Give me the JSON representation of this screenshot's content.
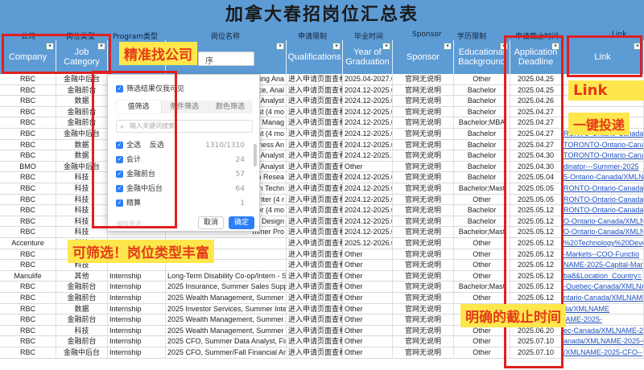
{
  "page": {
    "title": "加拿大春招岗位汇总表"
  },
  "sub_header": {
    "labels": [
      "公司",
      "岗位类型",
      "Program类型",
      "岗位名称",
      "申请限制",
      "毕业时间",
      "Sponsor",
      "学历限制",
      "申请截止时间",
      "Link"
    ]
  },
  "columns": [
    {
      "label": "Company"
    },
    {
      "label": "Job Category"
    },
    {
      "label": ""
    },
    {
      "label": ""
    },
    {
      "label": "Qualifications"
    },
    {
      "label": "Year of Graduation"
    },
    {
      "label": "Sponsor"
    },
    {
      "label": "Educational Background"
    },
    {
      "label": "Application Deadline"
    },
    {
      "label": "Link"
    }
  ],
  "rows": [
    {
      "company": "RBC",
      "cat": "金融中后台",
      "prog": "",
      "name": "",
      "qual": "进入申请页面查看",
      "year": "2025.04-2027.04",
      "spon": "官网无说明",
      "edu": "Other",
      "deadline": "2025.04.25",
      "link": ""
    },
    {
      "company": "RBC",
      "cat": "金融前台",
      "prog": "",
      "name": "",
      "qual": "进入申请页面查看",
      "year": "2024.12-2025.08",
      "spon": "官网无说明",
      "edu": "Bachelor",
      "deadline": "2025.04.25",
      "link": ""
    },
    {
      "company": "RBC",
      "cat": "数据",
      "prog": "",
      "name": "",
      "qual": "进入申请页面查看",
      "year": "2024.12-2025.08",
      "spon": "官网无说明",
      "edu": "Bachelor",
      "deadline": "2025.04.26",
      "link": ""
    },
    {
      "company": "RBC",
      "cat": "金融前台",
      "prog": "",
      "name": "",
      "qual": "进入申请页面查看",
      "year": "2024.12-2025.08",
      "spon": "官网无说明",
      "edu": "Bachelor",
      "deadline": "2025.04.27",
      "link": ""
    },
    {
      "company": "RBC",
      "cat": "金融前台",
      "prog": "",
      "name": "",
      "qual": "进入申请页面查看",
      "year": "2024.12-2025.08",
      "spon": "官网无说明",
      "edu": "Bachelor;MBA",
      "deadline": "2025.04.27",
      "link": ""
    },
    {
      "company": "RBC",
      "cat": "金融中后台",
      "prog": "",
      "name": "",
      "qual": "进入申请页面查看",
      "year": "2024.12-2025.08",
      "spon": "官网无说明",
      "edu": "Bachelor",
      "deadline": "2025.04.27",
      "link": "RONTO-Ontario-Canada/"
    },
    {
      "company": "RBC",
      "cat": "数据",
      "prog": "",
      "name": "",
      "qual": "进入申请页面查看",
      "year": "2024.12-2025.08",
      "spon": "官网无说明",
      "edu": "Bachelor",
      "deadline": "2025.04.27",
      "link": "TORONTO-Ontario-Canada/"
    },
    {
      "company": "RBC",
      "cat": "数据",
      "prog": "",
      "name": "",
      "qual": "进入申请页面查看",
      "year": "2024.12-2025.12",
      "spon": "官网无说明",
      "edu": "Bachelor",
      "deadline": "2025.04.30",
      "link": "TORONTO-Ontario-Canada/"
    },
    {
      "company": "BMO",
      "cat": "金融中后台",
      "prog": "",
      "name": "",
      "qual": "进入申请页面查看",
      "year": "Other",
      "spon": "官网无说明",
      "edu": "Bachelor",
      "deadline": "2025.04.30",
      "link": "dinator---Summer-2025"
    },
    {
      "company": "RBC",
      "cat": "科技",
      "prog": "",
      "name": "",
      "qual": "进入申请页面查看",
      "year": "2024.12-2025.08",
      "spon": "官网无说明",
      "edu": "Bachelor",
      "deadline": "2025.05.04",
      "link": "5-Ontario-Canada/XMLN"
    },
    {
      "company": "RBC",
      "cat": "科技",
      "prog": "",
      "name": "",
      "qual": "进入申请页面查看",
      "year": "2024.12-2025.08",
      "spon": "官网无说明",
      "edu": "Bachelor;Mast",
      "deadline": "2025.05.05",
      "link": "RONTO-Ontario-Canada/XMLN"
    },
    {
      "company": "RBC",
      "cat": "科技",
      "prog": "",
      "name": "",
      "qual": "进入申请页面查看",
      "year": "2024.12-2025.08",
      "spon": "官网无说明",
      "edu": "Other",
      "deadline": "2025.05.05",
      "link": "RONTO-Ontario-Canada/XMLN"
    },
    {
      "company": "RBC",
      "cat": "科技",
      "prog": "",
      "name": "",
      "qual": "进入申请页面查看",
      "year": "2024.12-2025.08",
      "spon": "官网无说明",
      "edu": "Bachelor",
      "deadline": "2025.05.12",
      "link": "RONTO-Ontario-Canada/XMLN"
    },
    {
      "company": "RBC",
      "cat": "科技",
      "prog": "",
      "name": "",
      "qual": "进入申请页面查看",
      "year": "2024.12-2025.08",
      "spon": "官网无说明",
      "edu": "Bachelor",
      "deadline": "2025.05.12",
      "link": "O-Ontario-Canada/XMLN"
    },
    {
      "company": "RBC",
      "cat": "科技",
      "prog": "",
      "name": "",
      "qual": "进入申请页面查看",
      "year": "2024.12-2025.08",
      "spon": "官网无说明",
      "edu": "Bachelor;Mast",
      "deadline": "2025.05.12",
      "link": "O-Ontario-Canada/XMLN"
    },
    {
      "company": "Accenture",
      "cat": "科技",
      "prog": "",
      "name": "",
      "qual": "进入申请页面查看",
      "year": "2025.12-2026.08",
      "spon": "官网无说明",
      "edu": "Other",
      "deadline": "2025.05.12",
      "link": "%20Technology%20Deve"
    },
    {
      "company": "RBC",
      "cat": "科技",
      "prog": "",
      "name": "",
      "qual": "进入申请页面查看",
      "year": "Other",
      "spon": "官网无说明",
      "edu": "Other",
      "deadline": "2025.05.12",
      "link": "-Markets--COO-Functio"
    },
    {
      "company": "RBC",
      "cat": "科技",
      "prog": "",
      "name": "",
      "qual": "进入申请页面查看",
      "year": "Other",
      "spon": "官网无说明",
      "edu": "Other",
      "deadline": "2025.05.12",
      "link": "NAME-2025-Capital-Marke"
    },
    {
      "company": "Manulife",
      "cat": "其他",
      "prog": "Internship",
      "name": "Long-Term Disability Co-op/Intern - Su",
      "qual": "进入申请页面查看",
      "year": "Other",
      "spon": "官网无说明",
      "edu": "Other",
      "deadline": "2025.05.12",
      "link": "ba8&Location_Country="
    },
    {
      "company": "RBC",
      "cat": "金融前台",
      "prog": "Internship",
      "name": "2025 Insurance, Summer Sales Suppo",
      "qual": "进入申请页面查看",
      "year": "Other",
      "spon": "官网无说明",
      "edu": "Bachelor;Mast",
      "deadline": "2025.05.12",
      "link": "-Quebec-Canada/XMLNAME-2"
    },
    {
      "company": "RBC",
      "cat": "金融前台",
      "prog": "Internship",
      "name": "2025 Wealth Management, Summer Int",
      "qual": "进入申请页面查看",
      "year": "Other",
      "spon": "官网无说明",
      "edu": "Other",
      "deadline": "2025.05.12",
      "link": "ntario-Canada/XMLNAME-2025-"
    },
    {
      "company": "RBC",
      "cat": "数据",
      "prog": "Internship",
      "name": "2025 Investor Services, Summer Inter",
      "qual": "进入申请页面查看",
      "year": "Other",
      "spon": "官网无说明",
      "edu": "Other",
      "deadline": "2025.05.12",
      "link": "da/XMLNAME"
    },
    {
      "company": "RBC",
      "cat": "金融前台",
      "prog": "Internship",
      "name": "2025 Wealth Management, Summer Ass",
      "qual": "进入申请页面查看",
      "year": "Other",
      "spon": "官网无说明",
      "edu": "Other",
      "deadline": "2025.05.15",
      "link": "IAME-2025-"
    },
    {
      "company": "RBC",
      "cat": "科技",
      "prog": "Internship",
      "name": "2025 Wealth Management, Summer Te",
      "qual": "进入申请页面查看",
      "year": "Other",
      "spon": "官网无说明",
      "edu": "Other",
      "deadline": "2025.06.20",
      "link": "ec-Canada/XMLNAME-2025-"
    },
    {
      "company": "RBC",
      "cat": "金融前台",
      "prog": "Internship",
      "name": "2025 CFO, Summer Data Analyst, Fina",
      "qual": "进入申请页面查看",
      "year": "Other",
      "spon": "官网无说明",
      "edu": "Other",
      "deadline": "2025.07.10",
      "link": "anada/XMLNAME-2025-CFO-"
    },
    {
      "company": "RBC",
      "cat": "金融中后台",
      "prog": "Internship",
      "name": "2025 CFO, Summer/Fall Financial Ana",
      "qual": "进入申请页面查看",
      "year": "Other",
      "spon": "官网无说明",
      "edu": "Other",
      "deadline": "2025.07.10",
      "link": "/XMLNAME-2025-CFO--"
    }
  ],
  "partial_names": [
    "ting Ana",
    "ice, Anal",
    "Analyst",
    "st (4 mo",
    "Manag",
    "st (4 mo",
    "siness An",
    "Analyst",
    "Analyst",
    "n Resea",
    "n Techn",
    "riter (4 r",
    "er (4 mo",
    "Design",
    "mmer Pro"
  ],
  "filter_popup": {
    "only_visible_label": "筛选结果仅我可见",
    "tabs": [
      "值筛选",
      "条件筛选",
      "颜色筛选"
    ],
    "search_placeholder": "输入关键词搜索",
    "select_all": "全选",
    "invert": "反选",
    "total": "1310/1310",
    "options": [
      {
        "label": "会计",
        "count": "24"
      },
      {
        "label": "金融前台",
        "count": "57"
      },
      {
        "label": "金融中后台",
        "count": "64"
      },
      {
        "label": "精算",
        "count": "1"
      }
    ],
    "clear_label": "清除筛选",
    "cancel": "取消",
    "ok": "确定",
    "partial_select": "序"
  },
  "callouts": {
    "find_company": "精准找公司",
    "link": "Link",
    "one_click": "一键投递",
    "filterable": "可筛选！岗位类型丰富",
    "deadline": "明确的截止时间"
  },
  "colors": {
    "header_blue": "#5d9bd5",
    "callout_yellow": "#fde74c",
    "callout_text": "#e53a1a",
    "red_box": "#e02020",
    "link_blue": "#1f4fbf"
  }
}
